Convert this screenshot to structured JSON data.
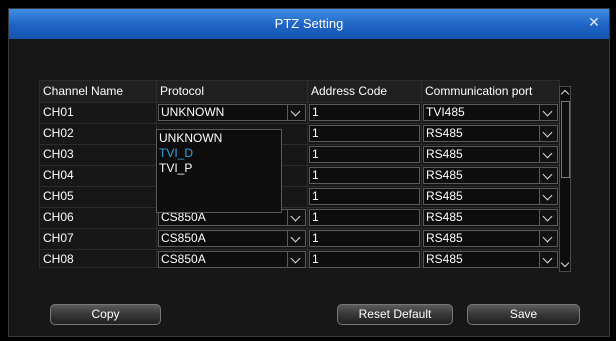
{
  "window": {
    "title": "PTZ Setting"
  },
  "table": {
    "headers": {
      "channel_name": "Channel Name",
      "protocol": "Protocol",
      "address_code": "Address Code",
      "communication_port": "Communication port"
    },
    "rows": [
      {
        "channel": "CH01",
        "protocol": "UNKNOWN",
        "address": "1",
        "port": "TVI485"
      },
      {
        "channel": "CH02",
        "protocol": "",
        "address": "1",
        "port": "RS485"
      },
      {
        "channel": "CH03",
        "protocol": "",
        "address": "1",
        "port": "RS485"
      },
      {
        "channel": "CH04",
        "protocol": "",
        "address": "1",
        "port": "RS485"
      },
      {
        "channel": "CH05",
        "protocol": "",
        "address": "1",
        "port": "RS485"
      },
      {
        "channel": "CH06",
        "protocol": "CS850A",
        "address": "1",
        "port": "RS485"
      },
      {
        "channel": "CH07",
        "protocol": "CS850A",
        "address": "1",
        "port": "RS485"
      },
      {
        "channel": "CH08",
        "protocol": "CS850A",
        "address": "1",
        "port": "RS485"
      }
    ]
  },
  "protocol_dropdown": {
    "options": [
      "UNKNOWN",
      "TVI_D",
      "TVI_P"
    ],
    "highlighted": "TVI_D"
  },
  "buttons": {
    "copy": "Copy",
    "reset_default": "Reset Default",
    "save": "Save"
  },
  "colors": {
    "title_bar": "#1e63c4",
    "highlight_text": "#36a2e0",
    "background": "#171717"
  }
}
